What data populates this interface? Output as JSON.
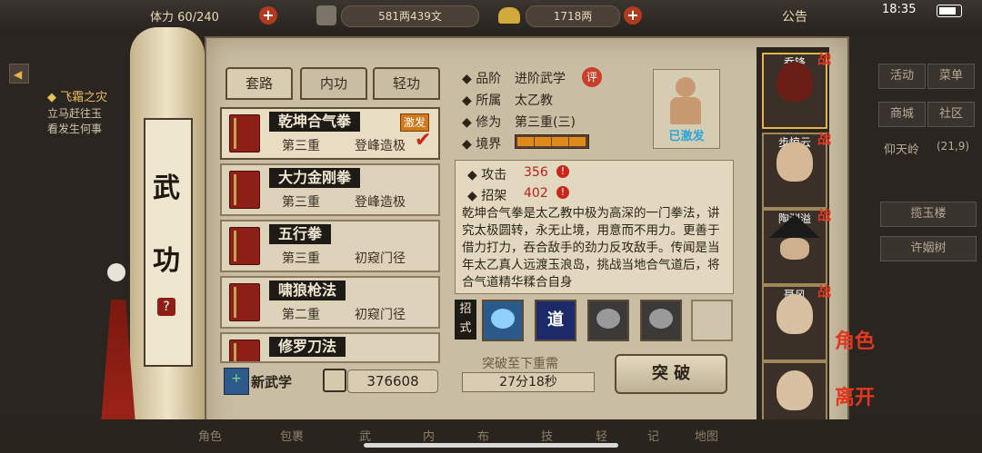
{
  "topbar": {
    "stamina_label": "体力",
    "stamina_value": "60/240",
    "copper": "581两439文",
    "silver": "1718两",
    "announcement": "公告",
    "time": "18:35"
  },
  "quest": {
    "title": "飞霜之灾",
    "line1": "立马赶往玉",
    "line2": "看发生何事"
  },
  "scroll": {
    "char1": "武",
    "char2": "功",
    "help": "?"
  },
  "tabs": [
    "套路",
    "内功",
    "轻功"
  ],
  "skills": [
    {
      "name": "乾坤合气拳",
      "level": "第三重",
      "rank": "登峰造极",
      "badge": "激发",
      "checked": true
    },
    {
      "name": "大力金刚拳",
      "level": "第三重",
      "rank": "登峰造极"
    },
    {
      "name": "五行拳",
      "level": "第三重",
      "rank": "初窥门径"
    },
    {
      "name": "啸狼枪法",
      "level": "第二重",
      "rank": "初窥门径"
    },
    {
      "name": "修罗刀法",
      "level": "",
      "rank": ""
    }
  ],
  "footer": {
    "new_skill": "新武学",
    "points": "376608"
  },
  "detail": {
    "grade_label": "品阶",
    "grade_value": "进阶武学",
    "grade_badge": "评",
    "belong_label": "所属",
    "belong_value": "太乙教",
    "cultivation_label": "修为",
    "cultivation_value": "第三重(三)",
    "realm_label": "境界",
    "realm_filled": 4,
    "realm_total": 4,
    "attack_label": "攻击",
    "attack_value": "356",
    "parry_label": "招架",
    "parry_value": "402",
    "description": "乾坤合气拳是太乙教中极为高深的一门拳法，讲究太极圆转，永无止境，用意而不用力。更善于借力打力，吞合敌手的劲力反攻敌手。传闻是当年太乙真人远渡玉浪岛，挑战当地合气道后，将合气道精华糅合自身",
    "activated": "已激发",
    "moves_label": "招式",
    "move_badge": "道"
  },
  "breakthrough": {
    "need_label": "突破至下重需",
    "time": "27分18秒",
    "button": "突 破"
  },
  "characters": [
    {
      "name": "乔锋",
      "tag": "战"
    },
    {
      "name": "步惊云",
      "tag": "战"
    },
    {
      "name": "陶渊溢",
      "tag": "战"
    },
    {
      "name": "聂风",
      "tag": "战"
    },
    {
      "name": "",
      "tag": ""
    }
  ],
  "side_menu": {
    "activity": "活动",
    "menu": "菜单",
    "mall": "商城",
    "community": "社区",
    "location": "仰天岭",
    "coords": "(21,9)",
    "btn1": "揽玉楼",
    "btn2": "许姻树",
    "role": "角色",
    "leave": "离开"
  },
  "bottom_nav": [
    "角色",
    "包裹",
    "武",
    "内",
    "布",
    "技",
    "轻",
    "记",
    "地图"
  ],
  "colors": {
    "accent_red": "#b23a1f",
    "parchment": "#c9bea4",
    "realm_bar": "#e08a1a"
  }
}
